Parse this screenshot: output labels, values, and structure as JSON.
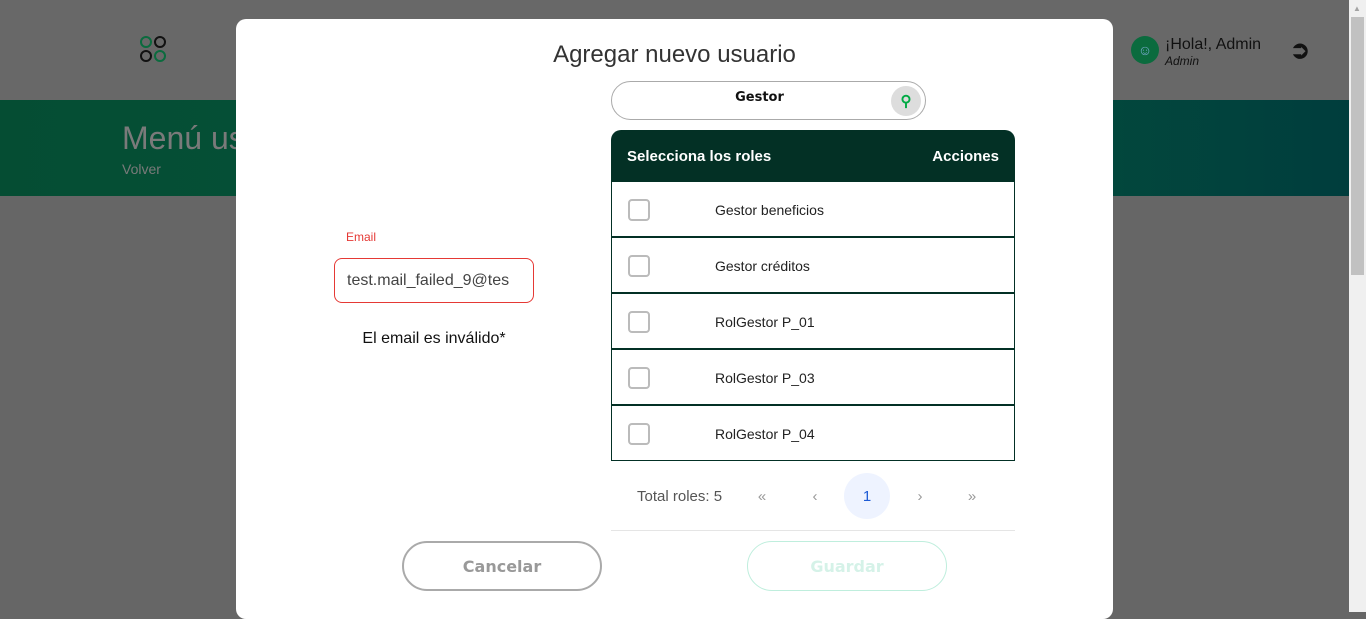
{
  "background": {
    "page_title": "Menú usuarios",
    "back": "Volver",
    "greeting": "¡Hola!, Admin",
    "user_role": "Admin"
  },
  "modal": {
    "title": "Agregar nuevo usuario",
    "search": {
      "value": "Gestor"
    },
    "table": {
      "header_left": "Selecciona los roles",
      "header_right": "Acciones",
      "rows": [
        {
          "label": "Gestor beneficios",
          "checked": false
        },
        {
          "label": "Gestor créditos",
          "checked": false
        },
        {
          "label": "RolGestor P_01",
          "checked": false
        },
        {
          "label": "RolGestor P_03",
          "checked": false
        },
        {
          "label": "RolGestor P_04",
          "checked": false
        }
      ]
    },
    "pagination": {
      "total": "Total roles: 5",
      "first": "«",
      "prev": "‹",
      "current": "1",
      "next": "›",
      "last": "»"
    },
    "email": {
      "label": "Email",
      "value": "test.mail_failed_9@tes",
      "error": "El email es inválido*"
    },
    "cancel": "Cancelar",
    "save": "Guardar"
  },
  "colors": {
    "brand": "#0b6b3e",
    "header": "#033025",
    "error": "#e53935",
    "page_active": "#1d5bd6"
  }
}
